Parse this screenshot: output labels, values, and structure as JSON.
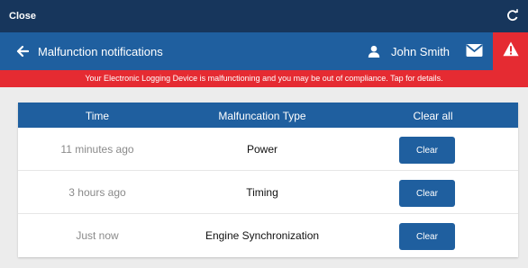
{
  "topbar": {
    "close_label": "Close",
    "refresh_icon": "refresh-icon"
  },
  "header": {
    "title": "Malfunction notifications",
    "user_name": "John Smith",
    "icons": [
      "arrow-left-icon",
      "user-icon",
      "mail-icon",
      "warning-icon"
    ]
  },
  "banner": {
    "text": "Your Electronic Logging Device is malfunctioning and you may be out of compliance. Tap for details."
  },
  "table": {
    "headers": {
      "time": "Time",
      "type": "Malfuncation Type",
      "clear_all": "Clear all"
    },
    "rows": [
      {
        "time": "11 minutes ago",
        "type": "Power",
        "action": "Clear"
      },
      {
        "time": "3 hours ago",
        "type": "Timing",
        "action": "Clear"
      },
      {
        "time": "Just now",
        "type": "Engine Synchronization",
        "action": "Clear"
      }
    ]
  },
  "colors": {
    "topbar": "#17365c",
    "header": "#1f5f9f",
    "alert": "#e52b32",
    "background": "#ececec"
  }
}
